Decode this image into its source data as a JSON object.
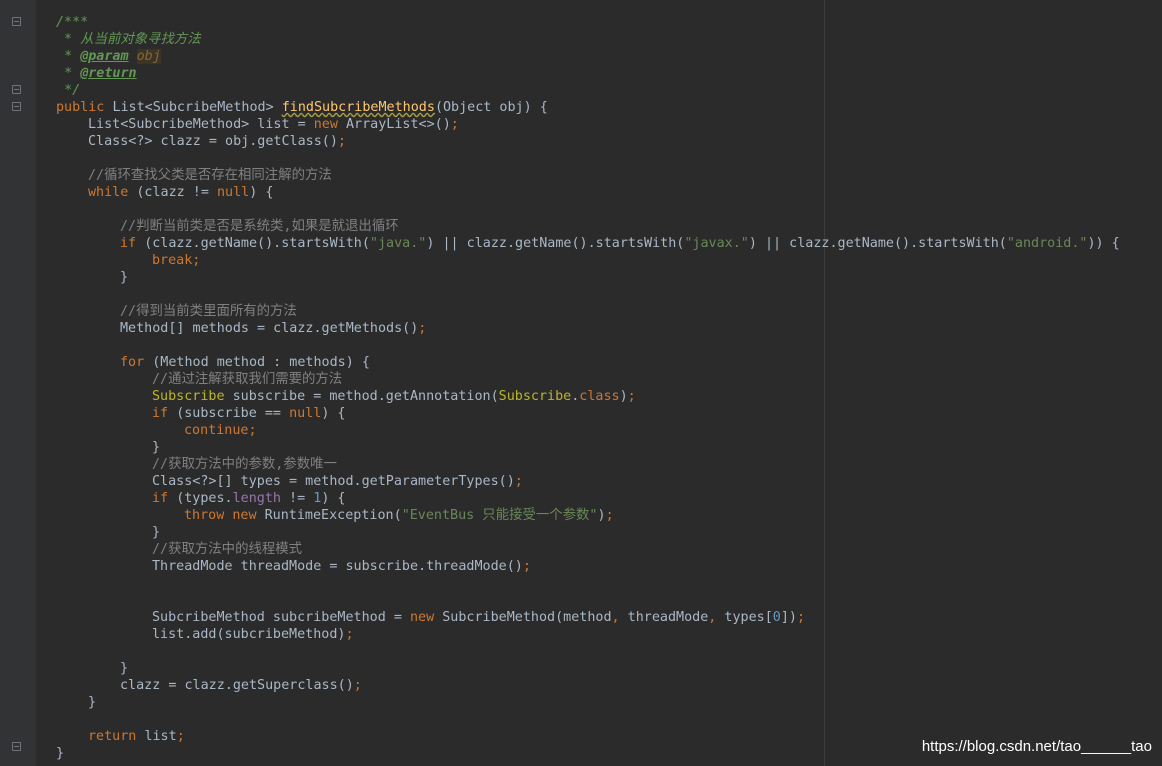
{
  "watermark": "https://blog.csdn.net/tao______tao",
  "doc": {
    "open": "/***",
    "summary": "* 从当前对象寻找方法",
    "star": "*",
    "param_tag": "@param",
    "param_name": "obj",
    "return_tag": "@return",
    "close": "*/"
  },
  "comments": {
    "find_parent": "//循环查找父类是否存在相同注解的方法",
    "is_system": "//判断当前类是否是系统类,如果是就退出循环",
    "get_methods": "//得到当前类里面所有的方法",
    "get_annotation": "//通过注解获取我们需要的方法",
    "get_params": "//获取方法中的参数,参数唯一",
    "get_thread_mode": "//获取方法中的线程模式"
  },
  "strings": {
    "java": "\"java.\"",
    "javax": "\"javax.\"",
    "android": "\"android.\"",
    "exception": "\"EventBus 只能接受一个参数\""
  },
  "numbers": {
    "one": "1",
    "zero": "0"
  },
  "colors": {
    "background": "#2b2b2b",
    "keyword": "#cc7832",
    "string": "#6a8759",
    "number": "#6897bb",
    "comment": "#808080",
    "doc_comment": "#629755",
    "method": "#ffc66d",
    "annotation": "#bbb529",
    "field": "#9876aa",
    "text": "#a9b7c6"
  }
}
